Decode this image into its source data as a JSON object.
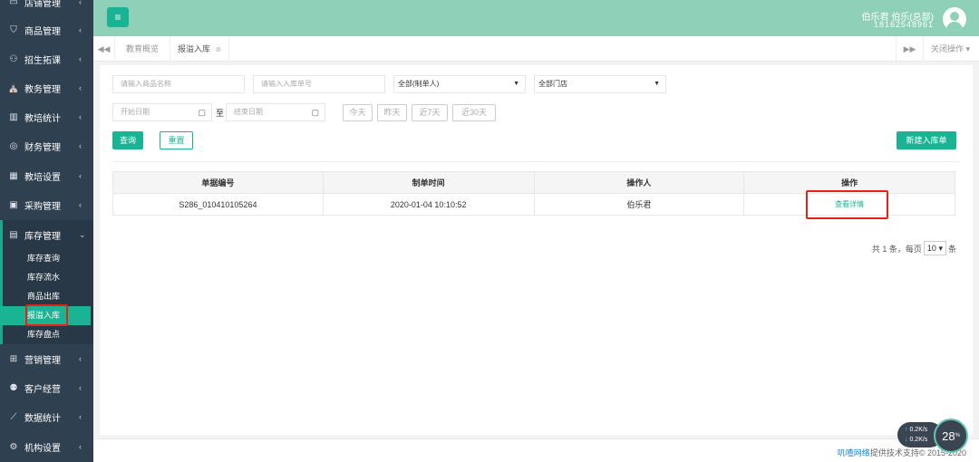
{
  "sidebar": {
    "items": [
      {
        "label": "店铺管理",
        "icon": "store-icon",
        "glyph": "▭"
      },
      {
        "label": "商品管理",
        "icon": "bag-icon",
        "glyph": "⛉"
      },
      {
        "label": "招生拓课",
        "icon": "user-icon",
        "glyph": "⚇"
      },
      {
        "label": "教务管理",
        "icon": "graduation-cap-icon",
        "glyph": "⛪"
      },
      {
        "label": "教培统计",
        "icon": "bar-chart-icon",
        "glyph": "▥"
      },
      {
        "label": "财务管理",
        "icon": "money-icon",
        "glyph": "◎"
      },
      {
        "label": "教培设置",
        "icon": "grid-icon",
        "glyph": "▦"
      },
      {
        "label": "采购管理",
        "icon": "cart-icon",
        "glyph": "▣"
      },
      {
        "label": "库存管理",
        "icon": "warehouse-icon",
        "glyph": "▤"
      },
      {
        "label": "营销管理",
        "icon": "apps-icon",
        "glyph": "⊞"
      },
      {
        "label": "客户经营",
        "icon": "customers-icon",
        "glyph": "⚉"
      },
      {
        "label": "数据统计",
        "icon": "line-chart-icon",
        "glyph": "⟋"
      },
      {
        "label": "机构设置",
        "icon": "settings-icon",
        "glyph": "⚙"
      }
    ],
    "submenu": [
      "库存查询",
      "库存流水",
      "商品出库",
      "报溢入库",
      "库存盘点"
    ]
  },
  "header": {
    "user_name": "伯乐君 伯乐(总部)",
    "user_phone": "18162548961"
  },
  "tabs": {
    "items": [
      "教育概览",
      "报溢入库"
    ],
    "close_ops": "关闭操作"
  },
  "filters": {
    "product_placeholder": "请输入商品名称",
    "order_no_placeholder": "请输入入库单号",
    "creator_select": "全部(制单人)",
    "store_select": "全部门店",
    "start_date_placeholder": "开始日期",
    "to_label": "至",
    "end_date_placeholder": "结束日期",
    "quick_dates": [
      "今天",
      "昨天",
      "近7天",
      "近30天"
    ],
    "search_label": "查询",
    "reset_label": "重置",
    "new_label": "新建入库单"
  },
  "table": {
    "headers": [
      "单据编号",
      "制单时间",
      "操作人",
      "操作"
    ],
    "rows": [
      {
        "doc_no": "S286_010410105264",
        "time": "2020-01-04 10:10:52",
        "operator": "伯乐君",
        "action": "查看详情"
      }
    ]
  },
  "pagination": {
    "prefix": "共 1 条，每页",
    "page_size": "10",
    "suffix": "条"
  },
  "footer": {
    "brand": "叽喳网络",
    "text": "提供技术支持© 2015-2020"
  },
  "net_widget": {
    "up": "0.2",
    "down": "0.2",
    "unit": "K/s",
    "percent": "28",
    "percent_unit": "%"
  },
  "colors": {
    "sidebar": "#2f4050",
    "header": "#8fd1b8",
    "accent": "#1ab394",
    "highlight": "#e2231a"
  }
}
